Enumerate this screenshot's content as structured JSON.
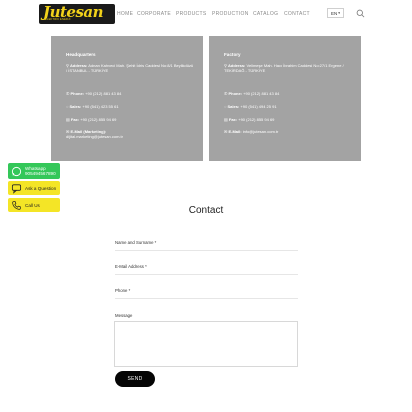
{
  "header": {
    "logo": {
      "name": "Jutesan",
      "tagline": "ELEKTRİK ENERJİ"
    },
    "nav": [
      "HOME",
      "CORPORATE",
      "PRODUCTS",
      "PRODUCTION",
      "CATALOG",
      "CONTACT"
    ],
    "language": "EN"
  },
  "headquarters": {
    "title": "Headquarters",
    "address_label": "Address:",
    "address": "Adnan Kahveci Mah. Şehit İdris Caddesi No:8/1 Beylikdüzü / İSTANBUL - TÜRKİYE",
    "phone_label": "Phone:",
    "phone": "+90 (212) 881 43 84",
    "sales_label": "Sales:",
    "sales": "+90 (541) 423 55 61",
    "fax_label": "Fax:",
    "fax": "+90 (212) 855 94 69",
    "email_label": "E-Mail (Marketing):",
    "email": "dijital.marketing@jutesan.com.tr"
  },
  "factory": {
    "title": "Factory",
    "address_label": "Address:",
    "address": "Velimeşe Mah. Hacı İbrahim Caddesi No:27/1 Ergene / TEKİRDAĞ - TÜRKİYE",
    "phone_label": "Phone:",
    "phone": "+90 (212) 881 43 84",
    "sales_label": "Sales:",
    "sales": "+90 (541) 494 25 91",
    "fax_label": "Fax:",
    "fax": "+90 (212) 855 94 69",
    "email_label": "E-Mail:",
    "email": "info@jutesan.com.tr"
  },
  "side_buttons": {
    "whatsapp_label": "Whatsapp",
    "whatsapp_number": "905494567890",
    "ask_label": "Ask a Question",
    "call_label": "Call Us"
  },
  "contact": {
    "title": "Contact",
    "name_label": "Name and Surname *",
    "email_label": "E-Mail Address *",
    "phone_label": "Phone *",
    "message_label": "Message",
    "send_label": "SEND"
  },
  "colors": {
    "accent": "#f2d21a",
    "card": "#a3a3a3",
    "whatsapp": "#34c759",
    "button": "#050505"
  }
}
